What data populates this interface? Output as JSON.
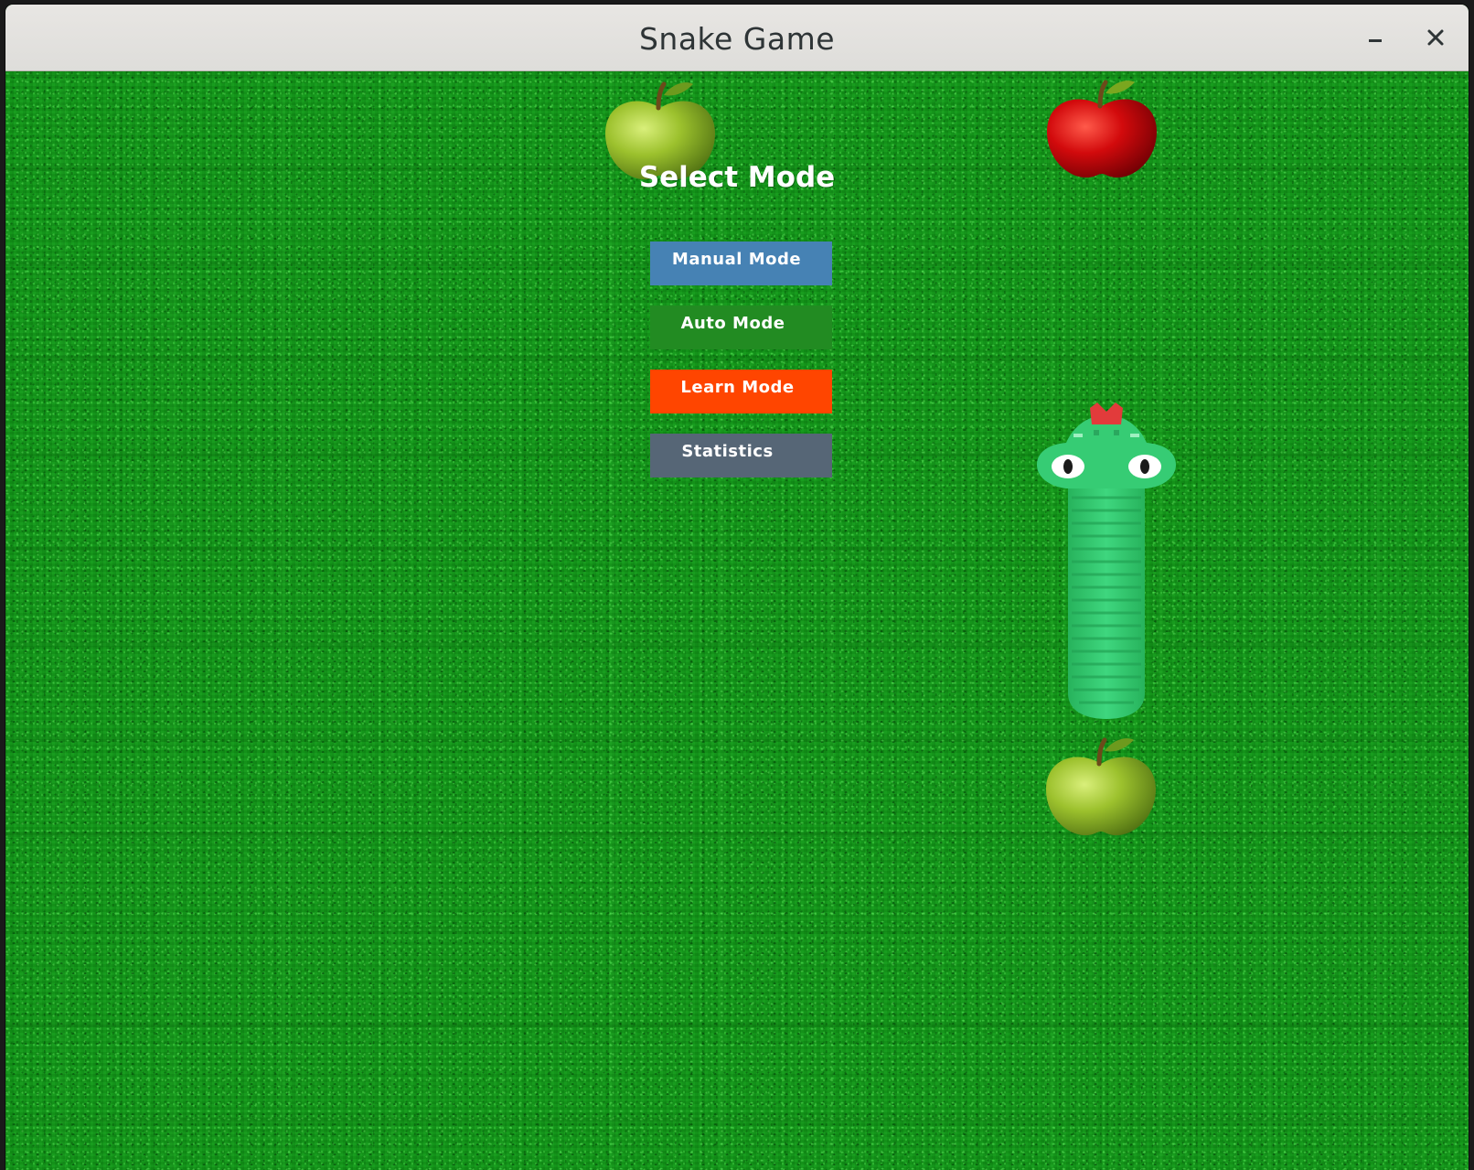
{
  "window": {
    "title": "Snake Game",
    "minimize_icon": "minimize-icon",
    "close_icon": "close-icon"
  },
  "menu": {
    "title": "Select Mode",
    "buttons": [
      {
        "label": "Manual Mode",
        "color": "#4682b4"
      },
      {
        "label": "Auto Mode",
        "color": "#228b22"
      },
      {
        "label": "Learn Mode",
        "color": "#ff4500"
      },
      {
        "label": "Statistics",
        "color": "#566676"
      }
    ]
  },
  "playfield": {
    "background": "grass-texture",
    "background_color": "#13961a",
    "sprites": [
      {
        "name": "green-apple",
        "color": "#8db526"
      },
      {
        "name": "red-apple",
        "color": "#c0060a"
      },
      {
        "name": "snake",
        "color": "#2ec46a",
        "orientation": "vertical, head up"
      },
      {
        "name": "green-apple",
        "color": "#8db526"
      }
    ]
  }
}
